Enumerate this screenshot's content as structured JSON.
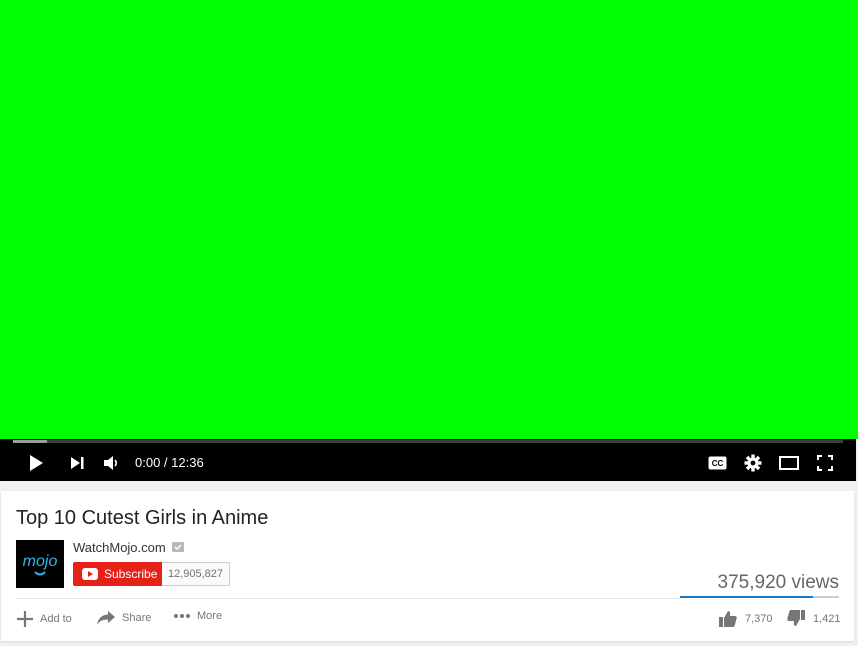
{
  "player": {
    "current_time": "0:00",
    "duration": "12:36",
    "time_display": "0:00 / 12:36",
    "progress_played": 0.0,
    "progress_buffered": 0.041,
    "video_color": "#00ff00"
  },
  "video": {
    "title": "Top 10 Cutest Girls in Anime",
    "views": "375,920 views",
    "likes": "7,370",
    "dislikes": "1,421",
    "like_ratio": 0.838
  },
  "channel": {
    "name": "WatchMojo.com",
    "logo_text": "mojo",
    "subscribe_label": "Subscribe",
    "subscriber_count": "12,905,827"
  },
  "actions": {
    "add_to": "Add to",
    "share": "Share",
    "more": "More"
  },
  "colors": {
    "subscribe": "#e62117",
    "like_bar": "#167ac6",
    "controls_bg": "#000000"
  }
}
